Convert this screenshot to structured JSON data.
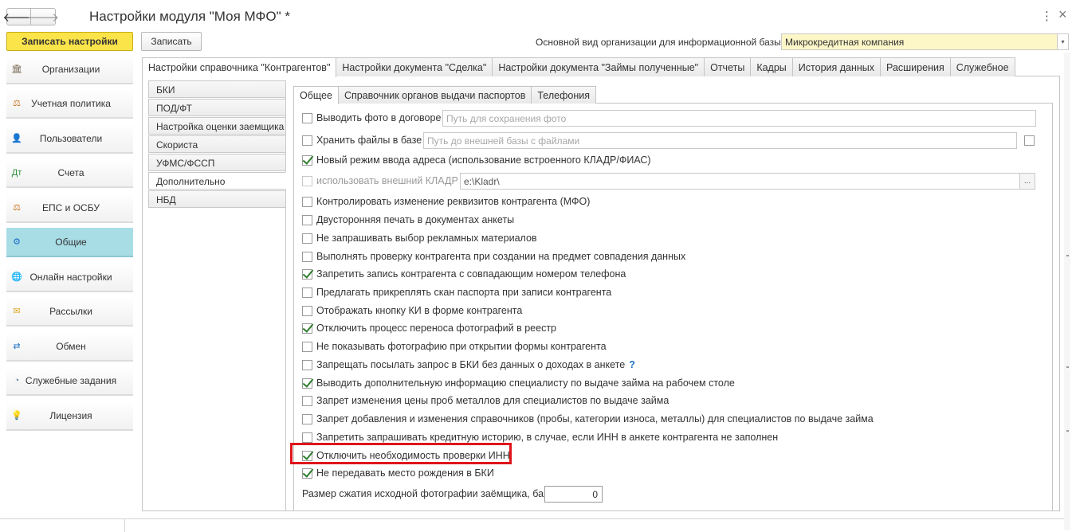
{
  "window": {
    "title": "Настройки модуля \"Моя МФО\" *",
    "back_glyph": "🡐",
    "forward_glyph": "🡒",
    "more_glyph": "⋮",
    "close_glyph": "×"
  },
  "toolbar": {
    "save_main_label": "Записать настройки",
    "save_label": "Записать",
    "org_type_label": "Основной вид организации для информационной базы:",
    "org_type_value": "Микрокредитная компания",
    "dropdown_glyph": "▾"
  },
  "sidebar": {
    "items": [
      {
        "label": "Организации",
        "icon": "🏛",
        "color": "#7a6a55"
      },
      {
        "label": "Учетная политика",
        "icon": "⚖",
        "color": "#c9731e"
      },
      {
        "label": "Пользователи",
        "icon": "👤",
        "color": "#6a4a3a"
      },
      {
        "label": "Счета",
        "icon": "Дт",
        "color": "#2c8f3a"
      },
      {
        "label": "ЕПС и ОСБУ",
        "icon": "⚖",
        "color": "#c9731e"
      },
      {
        "label": "Общие",
        "icon": "⚙",
        "color": "#1a6fc4"
      },
      {
        "label": "Онлайн настройки",
        "icon": "🌐",
        "color": "#1a6fc4"
      },
      {
        "label": "Рассылки",
        "icon": "✉",
        "color": "#e0a11b"
      },
      {
        "label": "Обмен",
        "icon": "⇄",
        "color": "#1a6fc4"
      },
      {
        "label": "Служебные задания",
        "icon": "◔",
        "color": "#5a7fa8"
      },
      {
        "label": "Лицензия",
        "icon": "💡",
        "color": "#e0a11b"
      }
    ]
  },
  "tabs": [
    "Настройки справочника \"Контрагентов\"",
    "Настройки документа \"Сделка\"",
    "Настройки документа \"Займы полученные\"",
    "Отчеты",
    "Кадры",
    "История данных",
    "Расширения",
    "Служебное"
  ],
  "sublist": [
    "БКИ",
    "ПОД/ФТ",
    "Настройка оценки заемщика",
    "Скориста",
    "УФМС/ФССП",
    "Дополнительно",
    "НБД"
  ],
  "inner_tabs": [
    "Общее",
    "Справочник органов выдачи паспортов",
    "Телефония"
  ],
  "options": [
    {
      "label": "Выводить фото в договоре",
      "checked": false
    },
    {
      "label": "Хранить файлы в базе",
      "checked": false
    },
    {
      "label": "Новый режим ввода адреса (использование встроенного КЛАДР/ФИАС)",
      "checked": true
    },
    {
      "label": "использовать внешний КЛАДР",
      "checked": false,
      "disabled": true
    },
    {
      "label": "Контролировать изменение реквизитов контрагента (МФО)",
      "checked": false
    },
    {
      "label": "Двусторонняя печать в документах анкеты",
      "checked": false
    },
    {
      "label": "Не запрашивать выбор рекламных материалов",
      "checked": false
    },
    {
      "label": "Выполнять проверку контрагента при создании на предмет совпадения данных",
      "checked": false
    },
    {
      "label": "Запретить запись контрагента с совпадающим номером телефона",
      "checked": true
    },
    {
      "label": "Предлагать прикреплять скан паспорта при записи контрагента",
      "checked": false
    },
    {
      "label": "Отображать кнопку КИ в форме контрагента",
      "checked": false
    },
    {
      "label": "Отключить процесс переноса фотографий в реестр",
      "checked": true
    },
    {
      "label": "Не показывать фотографию при открытии формы  контрагента",
      "checked": false
    },
    {
      "label": "Запрещать посылать запрос в БКИ без данных о доходах в анкете",
      "checked": false,
      "help": "?"
    },
    {
      "label": "Выводить дополнительную информацию  специалисту по выдаче займа на рабочем столе",
      "checked": true
    },
    {
      "label": "Запрет изменения цены проб металлов для специалистов по выдаче займа",
      "checked": false
    },
    {
      "label": "Запрет добавления и изменения справочников (пробы, категории износа, металлы) для специалистов по выдаче займа",
      "checked": false
    },
    {
      "label": "Запретить запрашивать кредитную историю, в случае, если ИНН в анкете контрагента не заполнен",
      "checked": false
    },
    {
      "label": "Отключить необходимость проверки ИНН",
      "checked": true
    },
    {
      "label": "Не передавать место рождения в БКИ",
      "checked": true
    }
  ],
  "fields": {
    "photo_path_placeholder": "Путь для сохранения фото",
    "files_path_placeholder": "Путь до внешней базы с файлами",
    "kladr_path": "e:\\Kladr\\",
    "kladr_select_glyph": "...",
    "compression_label": "Размер сжатия исходной фотографии заёмщика, байт:",
    "compression_value": "0"
  }
}
